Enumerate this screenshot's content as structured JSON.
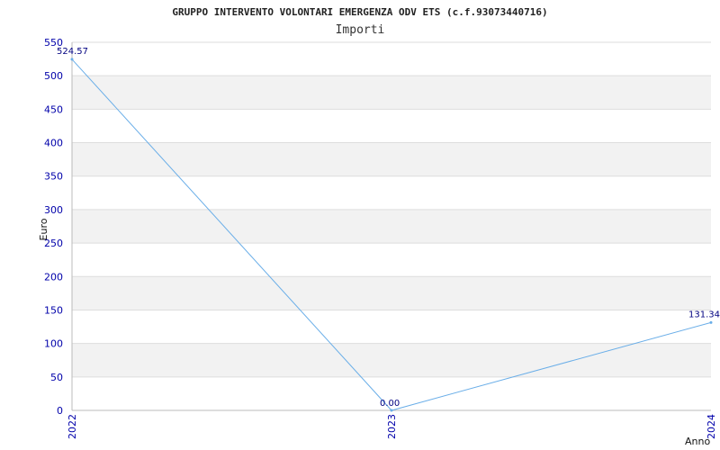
{
  "chart_data": {
    "type": "line",
    "title": "GRUPPO INTERVENTO VOLONTARI EMERGENZA ODV ETS (c.f.93073440716)",
    "subtitle": "Importi",
    "xlabel": "Anno",
    "ylabel": "Euro",
    "categories": [
      "2022",
      "2023",
      "2024"
    ],
    "series": [
      {
        "values": [
          524.57,
          0.0,
          131.34
        ],
        "labels": [
          "524.57",
          "0.00",
          "131.34"
        ]
      }
    ],
    "ylim": [
      0,
      550
    ],
    "yticks": [
      "0",
      "50",
      "100",
      "150",
      "200",
      "250",
      "300",
      "350",
      "400",
      "450",
      "500",
      "550"
    ],
    "grid": true,
    "colors": {
      "line": "#6aaee8",
      "band": "#f2f2f2",
      "grid": "#dddddd",
      "tick": "#0000aa"
    }
  }
}
